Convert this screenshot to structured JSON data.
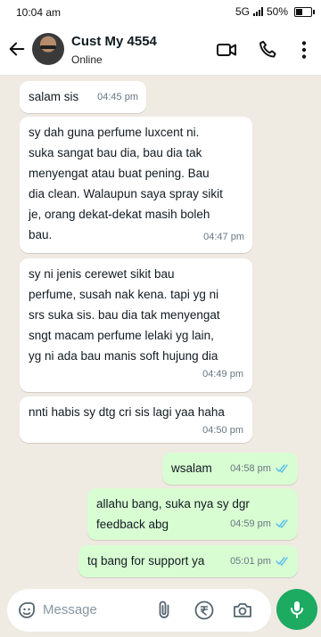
{
  "status_bar": {
    "time": "10:04 am",
    "network": "5G",
    "battery": "50%",
    "battery_level": 0.5
  },
  "header": {
    "contact_name": "Cust My 4554",
    "status": "Online"
  },
  "messages": [
    {
      "dir": "in",
      "text": "salam sis",
      "time": "04:45 pm"
    },
    {
      "dir": "in",
      "text": "sy dah guna perfume luxcent ni.\nsuka sangat bau dia, bau dia tak\nmenyengat atau buat pening. Bau\ndia clean. Walaupun saya spray sikit\nje, orang dekat-dekat masih boleh\nbau.",
      "time": "04:47 pm"
    },
    {
      "dir": "in",
      "text": "sy ni jenis cerewet sikit bau\nperfume, susah nak kena. tapi yg ni\nsrs suka sis. bau dia tak menyengat\nsngt macam perfume lelaki yg lain,\nyg ni ada bau manis soft hujung dia",
      "time": "04:49 pm"
    },
    {
      "dir": "in",
      "text": "nnti habis sy dtg cri sis lagi yaa haha",
      "time": "04:50 pm"
    },
    {
      "dir": "out",
      "text": "wsalam",
      "time": "04:58 pm"
    },
    {
      "dir": "out",
      "text": "allahu bang, suka nya sy dgr\nfeedback abg",
      "time": "04:59 pm"
    },
    {
      "dir": "out",
      "text": "tq bang for support ya",
      "time": "05:01 pm"
    }
  ],
  "composer": {
    "placeholder": "Message"
  },
  "colors": {
    "incoming": "#ffffff",
    "outgoing": "#d9fdd3",
    "accent": "#1daa61",
    "tick": "#53bdeb"
  }
}
